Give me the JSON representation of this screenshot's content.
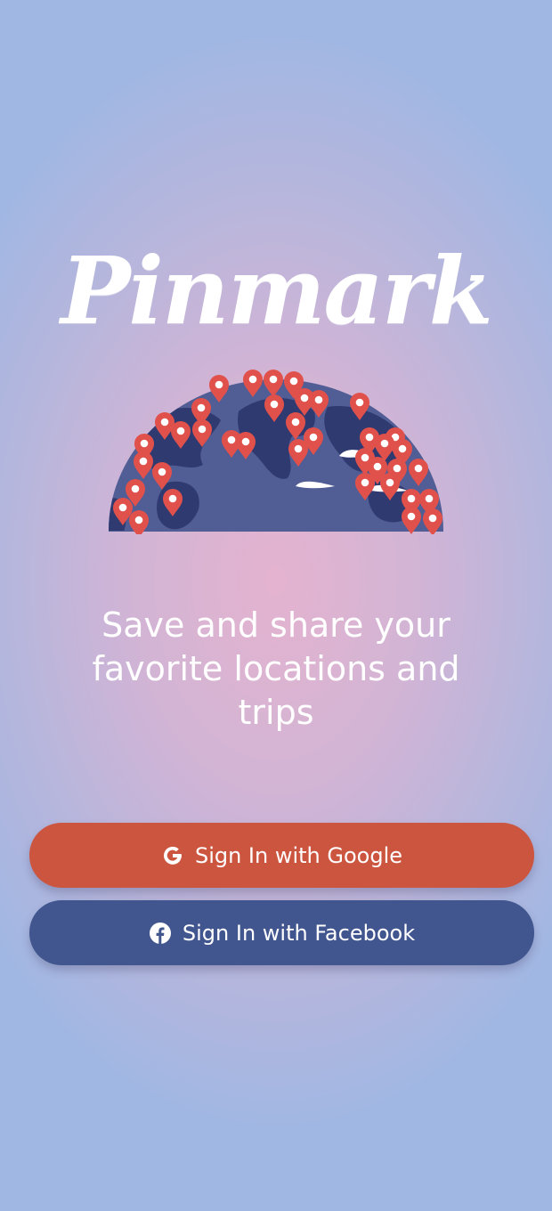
{
  "app": {
    "logo_text": "Pinmark",
    "tagline": "Save and share your favorite locations and trips"
  },
  "illustration": {
    "name": "globe-with-pins",
    "ocean_color": "#515d95",
    "land_color": "#2f3a70",
    "pin_color": "#e0514b",
    "cloud_color": "#ffffff"
  },
  "buttons": {
    "google": {
      "label": "Sign In with Google",
      "icon": "google-g-icon",
      "color": "#cc5540"
    },
    "facebook": {
      "label": "Sign In with Facebook",
      "icon": "facebook-f-icon",
      "color": "#41568f"
    }
  }
}
